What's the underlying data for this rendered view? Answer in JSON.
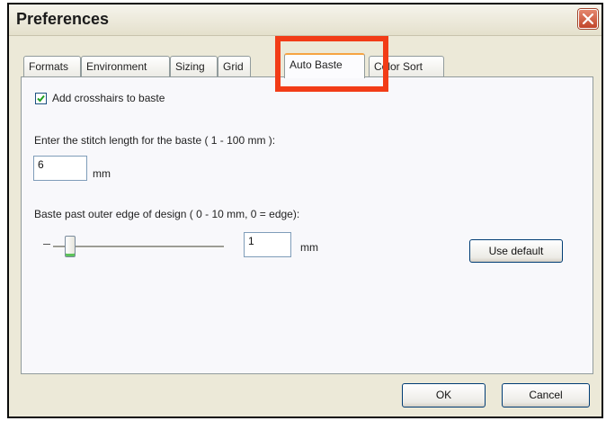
{
  "window": {
    "title": "Preferences"
  },
  "tabs": [
    {
      "label": "Formats"
    },
    {
      "label": "Environment"
    },
    {
      "label": "Sizing"
    },
    {
      "label": "Grid"
    },
    {
      "label": "Auto Baste",
      "active": true
    },
    {
      "label": "Color Sort"
    }
  ],
  "auto_baste": {
    "crosshairs_label": "Add crosshairs to baste",
    "crosshairs_checked": true,
    "stitch_length_label": "Enter the stitch length for the baste ( 1 - 100 mm ):",
    "stitch_length_value": "6",
    "stitch_length_unit": "mm",
    "baste_past_label": "Baste past outer edge of design ( 0 - 10 mm, 0 = edge):",
    "baste_past_value": "1",
    "baste_past_unit": "mm",
    "baste_past_slider_value": 1,
    "use_default_label": "Use default"
  },
  "footer": {
    "ok_label": "OK",
    "cancel_label": "Cancel"
  },
  "colors": {
    "highlight": "#f23c17",
    "active_tab_accent": "#f6a443",
    "close_button": "#c1452a"
  }
}
